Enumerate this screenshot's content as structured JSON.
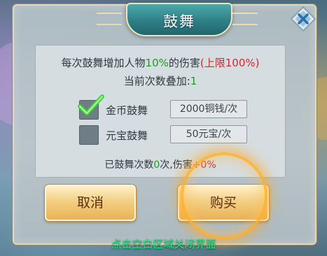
{
  "dialog": {
    "title": "鼓舞"
  },
  "info": {
    "line1_prefix": "每次鼓舞增加人物",
    "line1_percent": "10%",
    "line1_mid": "的伤害",
    "line1_limit": "(上限100%)",
    "stack_label": "当前次数叠加:",
    "stack_value": "1"
  },
  "options": [
    {
      "label": "金币鼓舞",
      "price": "2000铜钱/次",
      "checked": true
    },
    {
      "label": "元宝鼓舞",
      "price": "50元宝/次",
      "checked": false
    }
  ],
  "summary": {
    "prefix": "已鼓舞次数",
    "count": "0",
    "mid": "次,伤害",
    "damage": "+0%"
  },
  "buttons": {
    "cancel_label": "取消",
    "buy_label": "购买"
  },
  "hint": "点击空白区域关闭界面",
  "colors": {
    "highlight_green": "#1f9a25",
    "highlight_red": "#d12a2a",
    "hint_green": "#2fe28c",
    "title_teal": "#2f7f86",
    "button_gold": "#f3cf83"
  },
  "icons": {
    "close": "close-icon",
    "check": "checkmark-icon"
  }
}
